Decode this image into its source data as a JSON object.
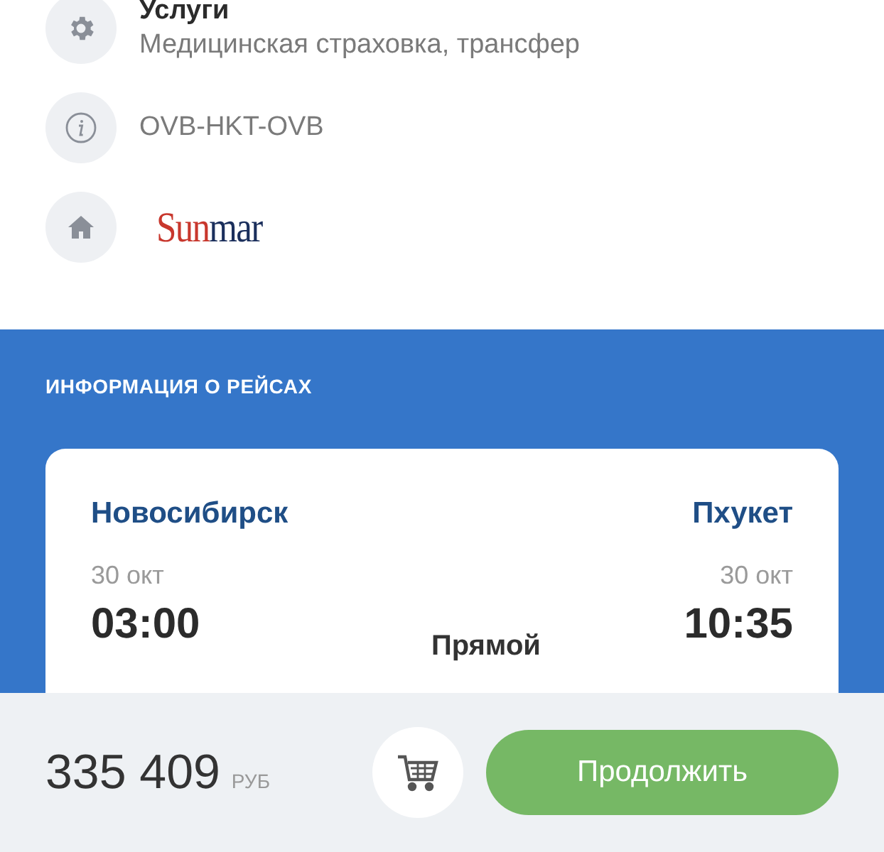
{
  "details": [
    {
      "kind": "services",
      "title": "Услуги",
      "text": "Медицинская страховка, трансфер"
    },
    {
      "kind": "info",
      "text": "OVB-HKT-OVB"
    },
    {
      "kind": "operator",
      "logo": [
        {
          "text": "Sun",
          "color": "#c8372d"
        },
        {
          "text": "mar",
          "color": "#1b2f5c"
        }
      ]
    }
  ],
  "flights": {
    "heading": "ИНФОРМАЦИЯ О РЕЙСАХ",
    "card": {
      "from": {
        "city": "Новосибирск",
        "date": "30 окт",
        "time": "03:00"
      },
      "to": {
        "city": "Пхукет",
        "date": "30 окт",
        "time": "10:35"
      },
      "type": "Прямой"
    }
  },
  "footer": {
    "price": "335 409",
    "currency": "РУБ",
    "button": "Продолжить"
  }
}
